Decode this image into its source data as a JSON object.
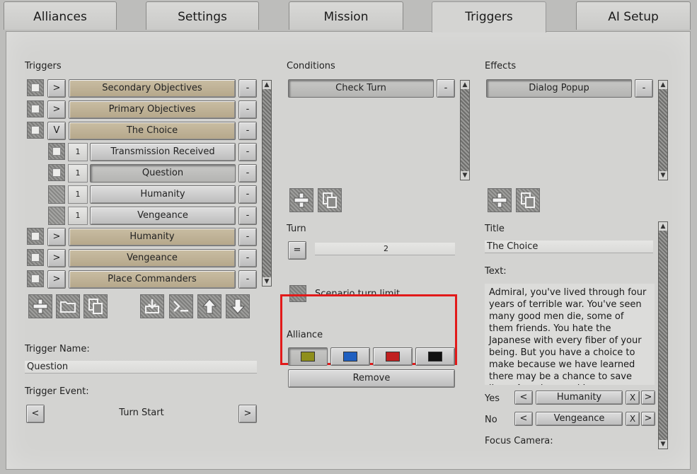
{
  "tabs": [
    {
      "label": "Alliances"
    },
    {
      "label": "Settings"
    },
    {
      "label": "Mission"
    },
    {
      "label": "Triggers"
    },
    {
      "label": "AI Setup"
    }
  ],
  "triggers": {
    "heading": "Triggers",
    "items": [
      {
        "expander": ">",
        "label": "Secondary Objectives",
        "remove": "-"
      },
      {
        "expander": ">",
        "label": "Primary Objectives",
        "remove": "-"
      },
      {
        "expander": "V",
        "label": "The Choice",
        "remove": "-"
      },
      {
        "expander": "1",
        "label": "Transmission Received",
        "remove": "-"
      },
      {
        "expander": "1",
        "label": "Question",
        "remove": "-"
      },
      {
        "expander": "1",
        "label": "Humanity",
        "remove": "-"
      },
      {
        "expander": "1",
        "label": "Vengeance",
        "remove": "-"
      },
      {
        "expander": ">",
        "label": "Humanity",
        "remove": "-"
      },
      {
        "expander": ">",
        "label": "Vengeance",
        "remove": "-"
      },
      {
        "expander": ">",
        "label": "Place Commanders",
        "remove": "-"
      }
    ],
    "name_label": "Trigger Name:",
    "name_value": "Question",
    "event_label": "Trigger Event:",
    "event_prev": "<",
    "event_value": "Turn Start",
    "event_next": ">"
  },
  "conditions": {
    "heading": "Conditions",
    "item": "Check Turn",
    "remove": "-",
    "turn_label": "Turn",
    "turn_op": "=",
    "turn_value": "2",
    "limit_label": "Scenario turn limit",
    "alliance_label": "Alliance",
    "alliance_colors": [
      "#8f8f1c",
      "#1f5fc0",
      "#c02020",
      "#111111"
    ],
    "remove_label": "Remove"
  },
  "effects": {
    "heading": "Effects",
    "item": "Dialog Popup",
    "remove": "-",
    "title_label": "Title",
    "title_value": "The Choice",
    "text_label": "Text:",
    "text_value": "Admiral, you've lived through four years of terrible war.  You've seen many good men die, some of them friends.  You hate the Japanese with every fiber of your being.   But you have a choice to make because we have learned there may be a chance to save lives, American and Japanese.",
    "yes_label": "Yes",
    "yes_value": "Humanity",
    "no_label": "No",
    "no_value": "Vengeance",
    "prev": "<",
    "next": ">",
    "clear": "X",
    "focus_label": "Focus Camera:"
  }
}
